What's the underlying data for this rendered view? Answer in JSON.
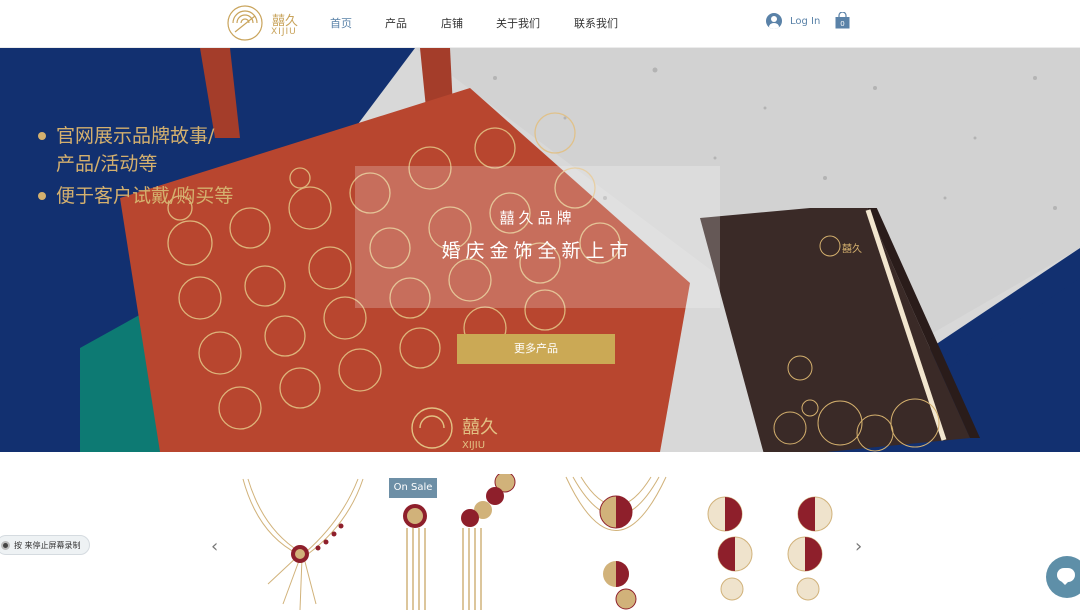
{
  "header": {
    "logo_text": "囍久",
    "logo_sub": "XIJIU",
    "nav": [
      "首页",
      "产品",
      "店铺",
      "关于我们",
      "联系我们"
    ],
    "active_nav": "首页",
    "login_label": "Log In",
    "cart_count": "0"
  },
  "hero": {
    "bullets": [
      "官网展示品牌故事/\n产品/活动等",
      "便于客户试戴/购买等"
    ],
    "brand_line": "囍久品牌",
    "tagline": "婚庆金饰全新上市",
    "cta_label": "更多产品",
    "bag_logo": "囍久",
    "bag_logo_sub": "XIJIU",
    "notebook_logo": "囍久"
  },
  "products": {
    "sale_badge": "On Sale",
    "prev_arrow": "‹",
    "next_arrow": "›"
  },
  "overlays": {
    "record_pill": "按 来停止屏幕录制"
  },
  "colors": {
    "navy": "#123070",
    "gold": "#d4b06e",
    "bag_red": "#b8462f",
    "teal": "#0d7a73",
    "notebook": "#3a2a27",
    "accent_blue": "#5a82a8",
    "cta": "#cba955"
  }
}
